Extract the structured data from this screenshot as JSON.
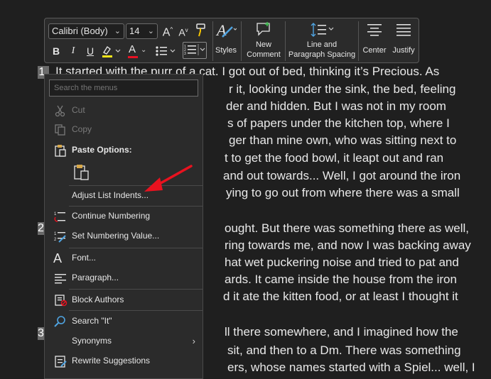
{
  "document": {
    "list_numbers": [
      "1.",
      "2",
      "3"
    ],
    "lines": [
      "It started with the purr of a cat. I got out of bed, thinking it’s Precious. As",
      "r it, looking under the sink, the bed, feeling",
      "der and hidden. But I was not in my room",
      "s of papers under the kitchen top, where I",
      "ger than mine own, who was sitting next to",
      "t to get the food bowl, it leapt out and ran",
      "and out towards... Well, I got around the iron",
      "ying to go out from where there was a small",
      "ought. But there was something there as well,",
      "ring towards me, and now I was backing away",
      "hat wet puckering noise and tried to pat and",
      "ards. It came inside the house from the iron",
      "d it ate the kitten food, or at least I thought it",
      "ll there somewhere, and I imagined how the",
      "sit, and then to a Dm. There was something",
      "ers, whose names started with a Spiel... well, I"
    ]
  },
  "toolbar": {
    "font_name": "Calibri (Body)",
    "font_size": "14",
    "grow_font": "A",
    "shrink_font": "A",
    "bold": "B",
    "italic": "I",
    "underline": "U",
    "font_color_letter": "A",
    "styles_label": "Styles",
    "new_comment_line1": "New",
    "new_comment_line2": "Comment",
    "line_spacing_line1": "Line and",
    "line_spacing_line2": "Paragraph Spacing",
    "center_label": "Center",
    "justify_label": "Justify",
    "highlight_color": "#f5e51b",
    "font_color": "#e81123"
  },
  "menu": {
    "search_placeholder": "Search the menus",
    "cut": "Cut",
    "copy": "Copy",
    "paste_options": "Paste Options:",
    "adjust_list_indents": "Adjust List Indents...",
    "continue_numbering": "Continue Numbering",
    "set_numbering_value": "Set Numbering Value...",
    "font": "Font...",
    "paragraph": "Paragraph...",
    "block_authors": "Block Authors",
    "search": "Search \"It\"",
    "synonyms": "Synonyms",
    "rewrite_suggestions": "Rewrite Suggestions"
  },
  "annotation": {
    "arrow_color": "#e8121f"
  }
}
